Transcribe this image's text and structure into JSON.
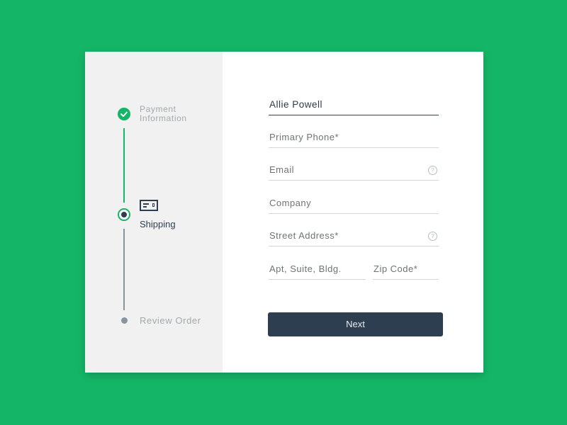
{
  "steps": [
    {
      "label_line1": "Payment",
      "label_line2": "Information",
      "state": "completed"
    },
    {
      "label": "Shipping",
      "state": "current"
    },
    {
      "label": "Review Order",
      "state": "upcoming"
    }
  ],
  "form": {
    "name_value": "Allie Powell",
    "phone_placeholder": "Primary Phone*",
    "email_placeholder": "Email",
    "company_placeholder": "Company",
    "street_placeholder": "Street Address*",
    "apt_placeholder": "Apt, Suite, Bldg.",
    "zip_placeholder": "Zip Code*",
    "help_glyph": "?"
  },
  "button": {
    "next_label": "Next"
  },
  "colors": {
    "accent": "#15b567",
    "dark": "#2c3e50"
  }
}
